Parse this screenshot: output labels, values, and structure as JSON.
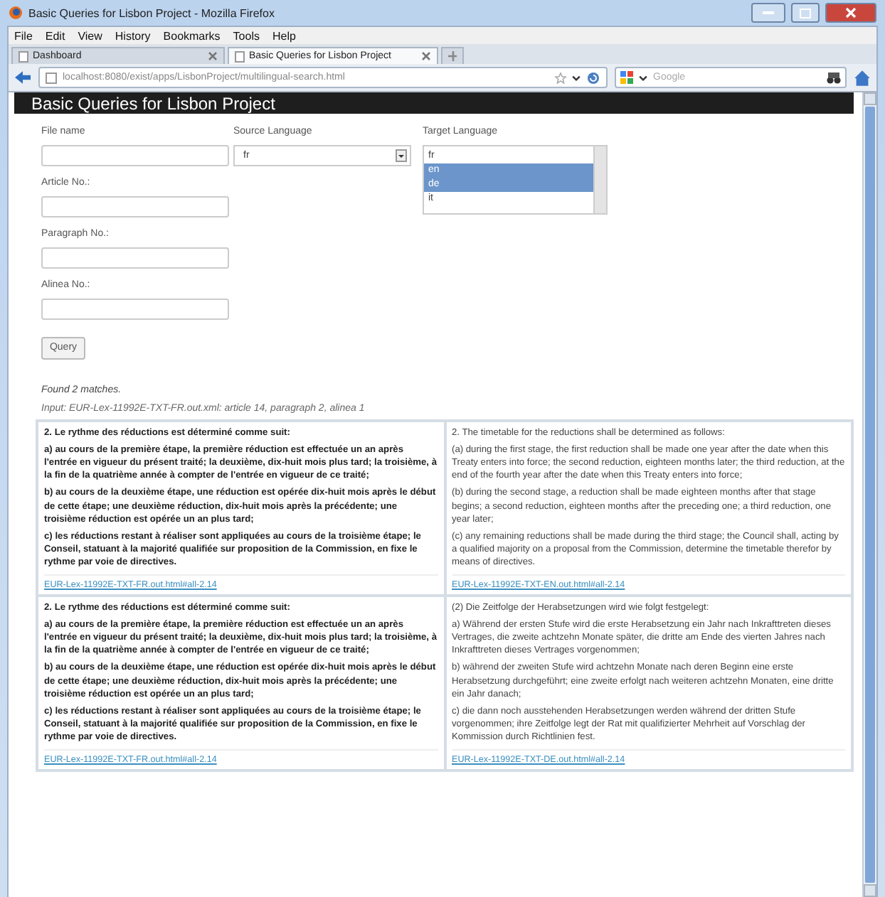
{
  "window": {
    "title": "Basic Queries for Lisbon Project - Mozilla Firefox"
  },
  "menu": [
    "File",
    "Edit",
    "View",
    "History",
    "Bookmarks",
    "Tools",
    "Help"
  ],
  "tabs": [
    {
      "label": "Dashboard",
      "selected": false
    },
    {
      "label": "Basic Queries for Lisbon Project",
      "selected": true
    }
  ],
  "address_bar": {
    "url": "localhost:8080/exist/apps/LisbonProject/multilingual-search.html"
  },
  "search_field": {
    "placeholder": "Google"
  },
  "page": {
    "heading": "Basic Queries for Lisbon Project",
    "form": {
      "file_name": {
        "label": "File name"
      },
      "source_language": {
        "label": "Source Language",
        "value": "fr"
      },
      "target_language": {
        "label": "Target Language",
        "options": [
          {
            "label": "fr",
            "selected": false
          },
          {
            "label": "en",
            "selected": true
          },
          {
            "label": "de",
            "selected": true
          },
          {
            "label": "it",
            "selected": false
          }
        ]
      },
      "article_no": {
        "label": "Article No.:"
      },
      "paragraph_no": {
        "label": "Paragraph No.:"
      },
      "alinea_no": {
        "label": "Alinea No.:"
      },
      "query_button": "Query"
    },
    "found": "Found 2 matches.",
    "input_line": "Input: EUR-Lex-11992E-TXT-FR.out.xml: article 14, paragraph 2, alinea 1",
    "results": [
      {
        "source": {
          "paragraphs": [
            "2. Le rythme des réductions est déterminé comme suit:",
            "a) au cours de la première étape, la première réduction est effectuée un an après l'entrée en vigueur du présent traité; la deuxième, dix-huit mois plus tard; la troisième, à la fin de la quatrième année à compter de l'entrée en vigueur de ce traité;",
            "b) au cours de la deuxième étape, une réduction est opérée dix-huit mois après le début de cette étape; une deuxième réduction, dix-huit mois après la précédente; une troisième réduction est opérée un an plus tard;",
            "c) les réductions restant à réaliser sont appliquées au cours de la troisième étape; le Conseil, statuant à la majorité qualifiée sur proposition de la Commission, en fixe le rythme par voie de directives."
          ],
          "link": "EUR-Lex-11992E-TXT-FR.out.html#all-2.14"
        },
        "target": {
          "paragraphs": [
            "2. The timetable for the reductions shall be determined as follows:",
            "(a) during the first stage, the first reduction shall be made one year after the date when this Treaty enters into force; the second reduction, eighteen months later; the third reduction, at the end of the fourth year after the date when this Treaty enters into force;",
            "(b) during the second stage, a reduction shall be made eighteen months after that stage begins; a second reduction, eighteen months after the preceding one; a third reduction, one year later;",
            "(c) any remaining reductions shall be made during the third stage; the Council shall, acting by a qualified majority on a proposal from the Commission, determine the timetable therefor by means of directives."
          ],
          "link": "EUR-Lex-11992E-TXT-EN.out.html#all-2.14"
        }
      },
      {
        "source": {
          "paragraphs": [
            "2. Le rythme des réductions est déterminé comme suit:",
            "a) au cours de la première étape, la première réduction est effectuée un an après l'entrée en vigueur du présent traité; la deuxième, dix-huit mois plus tard; la troisième, à la fin de la quatrième année à compter de l'entrée en vigueur de ce traité;",
            "b) au cours de la deuxième étape, une réduction est opérée dix-huit mois après le début de cette étape; une deuxième réduction, dix-huit mois après la précédente; une troisième réduction est opérée un an plus tard;",
            "c) les réductions restant à réaliser sont appliquées au cours de la troisième étape; le Conseil, statuant à la majorité qualifiée sur proposition de la Commission, en fixe le rythme par voie de directives."
          ],
          "link": "EUR-Lex-11992E-TXT-FR.out.html#all-2.14"
        },
        "target": {
          "paragraphs": [
            "(2) Die Zeitfolge der Herabsetzungen wird wie folgt festgelegt:",
            "a) Während der ersten Stufe wird die erste Herabsetzung ein Jahr nach Inkrafttreten dieses Vertrages, die zweite achtzehn Monate später, die dritte am Ende des vierten Jahres nach Inkrafttreten dieses Vertrages vorgenommen;",
            "b) während der zweiten Stufe wird achtzehn Monate nach deren Beginn eine erste Herabsetzung durchgeführt; eine zweite erfolgt nach weiteren achtzehn Monaten, eine dritte ein Jahr danach;",
            "c) die dann noch ausstehenden Herabsetzungen werden während der dritten Stufe vorgenommen; ihre Zeitfolge legt der Rat mit qualifizierter Mehrheit auf Vorschlag der Kommission durch Richtlinien fest."
          ],
          "link": "EUR-Lex-11992E-TXT-DE.out.html#all-2.14"
        }
      }
    ]
  }
}
